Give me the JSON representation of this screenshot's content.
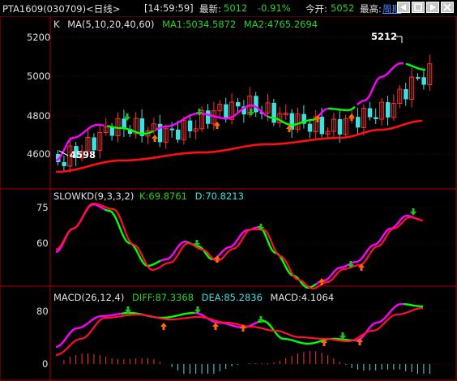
{
  "topbar": {
    "title": "PTA1609(030709)<日线>",
    "time": "[14:59:59]",
    "latest_label": "最新:",
    "latest_value": "5012",
    "change_pct": "-0.91%",
    "open_label": "今开:",
    "open_value": "5052",
    "high_label": "最高:",
    "period_link": "周期",
    "buttons": [
      "nav-prev",
      "nav-zoom",
      "nav-next",
      "nav-close"
    ]
  },
  "main_panel": {
    "legend_k": "K",
    "legend_ma": "MA(5,10,20,40,60)",
    "legend_ma1": "MA1:5034.5872",
    "legend_ma2": "MA2:4765.2694",
    "ticks": [
      "5200",
      "5000",
      "4800",
      "4600"
    ],
    "high_label": "5212",
    "low_label": "4598"
  },
  "kd_panel": {
    "legend_title": "SLOWKD(9,3,3,2)",
    "legend_k": "K:69.8761",
    "legend_d": "D:70.8213",
    "ticks": [
      "75",
      "60"
    ]
  },
  "macd_panel": {
    "legend_title": "MACD(26,12,4)",
    "legend_diff": "DIFF:87.3368",
    "legend_dea": "DEA:85.2836",
    "legend_macd": "MACD:4.1064",
    "ticks": [
      "80",
      "0"
    ]
  },
  "colors": {
    "up": "#ff3030",
    "down": "#40e0e0",
    "ma_up": "#ff00ff",
    "ma_down": "#00ff00",
    "ma2": "#ff1010",
    "axis": "#b00000",
    "arrow_up": "#ff6a00",
    "arrow_down": "#20c020"
  }
}
